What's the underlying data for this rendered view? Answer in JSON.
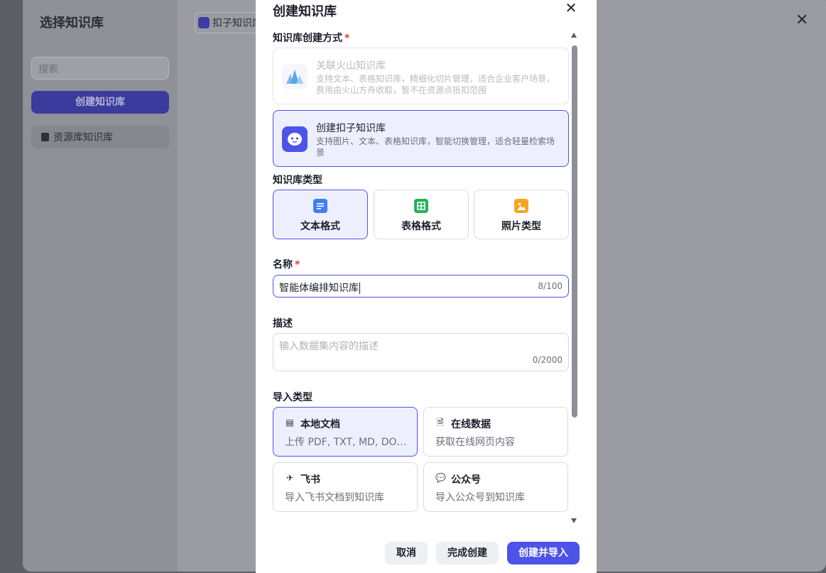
{
  "background": {
    "title": "选择知识库",
    "search_placeholder": "搜索",
    "create_button": "创建知识库",
    "sidebar_item": "资源库知识库",
    "chip_label": "扣子知识库"
  },
  "modal": {
    "title": "创建知识库",
    "method_label": "知识库创建方式",
    "required_mark": "*",
    "methods": [
      {
        "title": "关联火山知识库",
        "desc": "支持文本、表格知识库，精细化切片管理，适合企业客户场景，费用由火山方舟收取，暂不在资源点抵扣范围",
        "state": "disabled"
      },
      {
        "title": "创建扣子知识库",
        "desc": "支持图片、文本、表格知识库，智能切换管理，适合轻量检索场景",
        "state": "selected"
      }
    ],
    "type_label": "知识库类型",
    "types": [
      {
        "label": "文本格式",
        "icon": "text-doc-icon",
        "color": "#3f7ff5"
      },
      {
        "label": "表格格式",
        "icon": "table-icon",
        "color": "#22b45a"
      },
      {
        "label": "照片类型",
        "icon": "image-icon",
        "color": "#f5a524"
      }
    ],
    "name_label": "名称",
    "name_value": "智能体编排知识库",
    "name_counter": "8/100",
    "desc_label": "描述",
    "desc_placeholder": "输入数据集内容的描述",
    "desc_counter": "0/2000",
    "import_label": "导入类型",
    "imports": [
      {
        "title": "本地文档",
        "desc": "上传 PDF, TXT, MD, DOC, DOCX 格式的本地文件",
        "icon": "local-file-icon",
        "glyph": "▤"
      },
      {
        "title": "在线数据",
        "desc": "获取在线网页内容",
        "icon": "online-data-icon",
        "glyph": "🗎"
      },
      {
        "title": "飞书",
        "desc": "导入飞书文档到知识库",
        "icon": "feishu-icon",
        "glyph": "✈"
      },
      {
        "title": "公众号",
        "desc": "导入公众号到知识库",
        "icon": "wechat-icon",
        "glyph": "💬"
      }
    ],
    "buttons": {
      "cancel": "取消",
      "done": "完成创建",
      "create_import": "创建并导入"
    }
  },
  "colors": {
    "accent": "#4d53e8",
    "required": "#e53935"
  }
}
